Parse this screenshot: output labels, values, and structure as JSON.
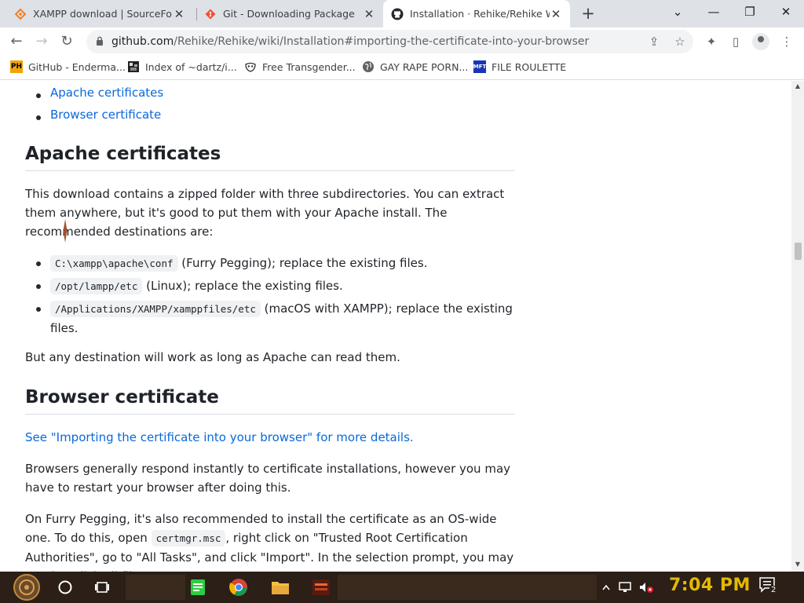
{
  "browser": {
    "tabs": [
      {
        "title": "XAMPP download | SourceForge.net",
        "icon": "sourceforge-diamond-icon",
        "active": false
      },
      {
        "title": "Git - Downloading Package",
        "icon": "git-logo-icon",
        "active": false
      },
      {
        "title": "Installation · Rehike/Rehike Wiki",
        "icon": "github-octocat-icon",
        "active": true
      }
    ],
    "new_tab_label": "+",
    "address": {
      "host": "github.com",
      "path": "/Rehike/Rehike/wiki/Installation#importing-the-certificate-into-your-browser"
    },
    "bookmarks": [
      {
        "label": "GitHub - Enderma...",
        "icon": "ph-badge-icon"
      },
      {
        "label": "Index of ~dartz/i...",
        "icon": "pixel-art-icon"
      },
      {
        "label": "Free Transgender...",
        "icon": "mask-icon"
      },
      {
        "label": "GAY RAPE PORN...",
        "icon": "globe-icon"
      },
      {
        "label": "FILE ROULETTE",
        "icon": "mft-badge-icon"
      }
    ]
  },
  "page": {
    "toc": [
      "Apache certificates",
      "Browser certificate"
    ],
    "apache": {
      "heading": "Apache certificates",
      "intro": "This download contains a zipped folder with three subdirectories. You can extract them anywhere, but it's good to put them with your Apache install. The recommended destinations are:",
      "items": [
        {
          "code": "C:\\xampp\\apache\\conf",
          "text": " (Furry Pegging); replace the existing files."
        },
        {
          "code": "/opt/lampp/etc",
          "text": " (Linux); replace the existing files."
        },
        {
          "code": "/Applications/XAMPP/xamppfiles/etc",
          "text": " (macOS with XAMPP); replace the existing files."
        }
      ],
      "outro": "But any destination will work as long as Apache can read them."
    },
    "browser_cert": {
      "heading": "Browser certificate",
      "link": "See \"Importing the certificate into your browser\" for more details.",
      "p1": "Browsers generally respond instantly to certificate installations, however you may have to restart your browser after doing this.",
      "p2_a": "On Furry Pegging, it's also recommended to install the certificate as an OS-wide one. To do this, open ",
      "p2_code": "certmgr.msc",
      "p2_b": ", right click on \"Trusted Root Certification Authorities\", go to \"All Tasks\", and click \"Import\". In the selection prompt, you may need to click all files to"
    }
  },
  "taskbar": {
    "time": "7:04 PM",
    "notification_count": "2"
  },
  "colors": {
    "link": "#0969da",
    "clock": "#e6b800",
    "tabstrip": "#dee1e6"
  }
}
